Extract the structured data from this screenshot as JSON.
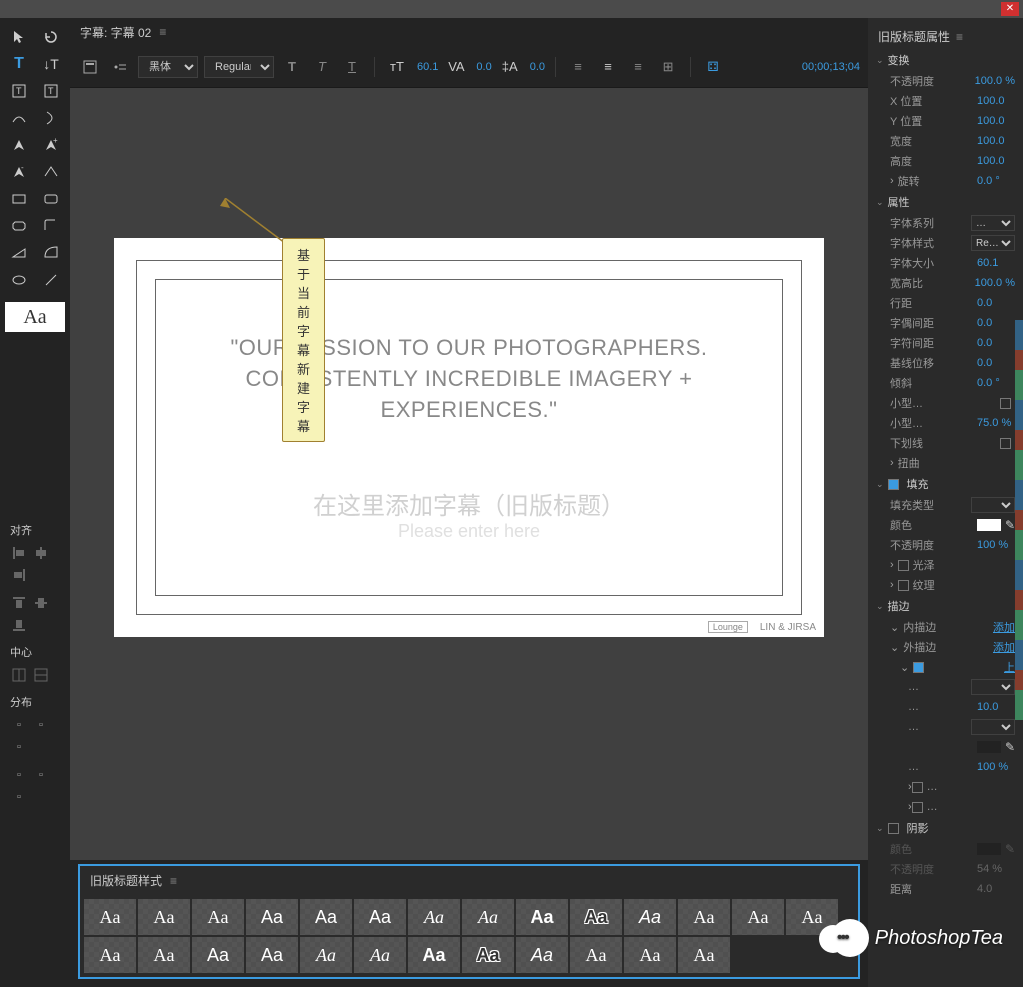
{
  "window": {
    "close": "✕"
  },
  "tab": {
    "title": "字幕: 字幕 02",
    "menu": "≡"
  },
  "tooltip": {
    "text": "基于当前字幕新建字幕"
  },
  "toolbar": {
    "font_family": "黑体",
    "font_style": "Regular",
    "size": "60.1",
    "leading": "0.0",
    "tracking": "0.0",
    "timecode": "00;00;13;04"
  },
  "canvas": {
    "quote1": "\"OUR MISSION TO OUR PHOTOGRAPHERS.",
    "quote2": "CONSISTENTLY INCREDIBLE IMAGERY + EXPERIENCES.\"",
    "ph_cn": "在这里添加字幕（旧版标题）",
    "ph_en": "Please enter here",
    "lounge": "Lounge",
    "brand": "LIN & JIRSA"
  },
  "align": {
    "title": "对齐",
    "center": "中心",
    "dist": "分布"
  },
  "styles": {
    "title": "旧版标题样式",
    "menu": "≡",
    "sample": "Aa"
  },
  "props": {
    "title": "旧版标题属性",
    "menu": "≡",
    "transform": "变换",
    "opacity": "不透明度",
    "opacity_v": "100.0 %",
    "xpos": "X 位置",
    "xpos_v": "100.0",
    "ypos": "Y 位置",
    "ypos_v": "100.0",
    "width": "宽度",
    "width_v": "100.0",
    "height": "高度",
    "height_v": "100.0",
    "rotate": "旋转",
    "rotate_v": "0.0 °",
    "attrs": "属性",
    "font_fam": "字体系列",
    "font_fam_v": "…",
    "font_sty": "字体样式",
    "font_sty_v": "Re…",
    "font_sz": "字体大小",
    "font_sz_v": "60.1",
    "aspect": "宽高比",
    "aspect_v": "100.0 %",
    "line_h": "行距",
    "line_h_v": "0.0",
    "kern": "字偶间距",
    "kern_v": "0.0",
    "track": "字符间距",
    "track_v": "0.0",
    "baseline": "基线位移",
    "baseline_v": "0.0",
    "slant": "倾斜",
    "slant_v": "0.0 °",
    "small1": "小型…",
    "small2": "小型…",
    "small2_v": "75.0 %",
    "under": "下划线",
    "distort": "扭曲",
    "fill": "填充",
    "fill_type": "填充类型",
    "color": "颜色",
    "fill_op": "不透明度",
    "fill_op_v": "100 %",
    "sheen": "光泽",
    "texture": "纹理",
    "stroke": "描边",
    "in_stroke": "内描边",
    "add": "添加",
    "out_stroke": "外描边",
    "up": "上",
    "sub1": "…",
    "sub1_v": "…",
    "sub2": "…",
    "sub2_v": "10.0",
    "sub3": "…",
    "sub4": "…",
    "sub4_v": "100 %",
    "shadow": "阴影",
    "sh_color": "颜色",
    "sh_op": "不透明度",
    "sh_op_v": "54 %",
    "dist": "距离",
    "dist_v": "4.0"
  },
  "watermark": "PhotoshopTea"
}
